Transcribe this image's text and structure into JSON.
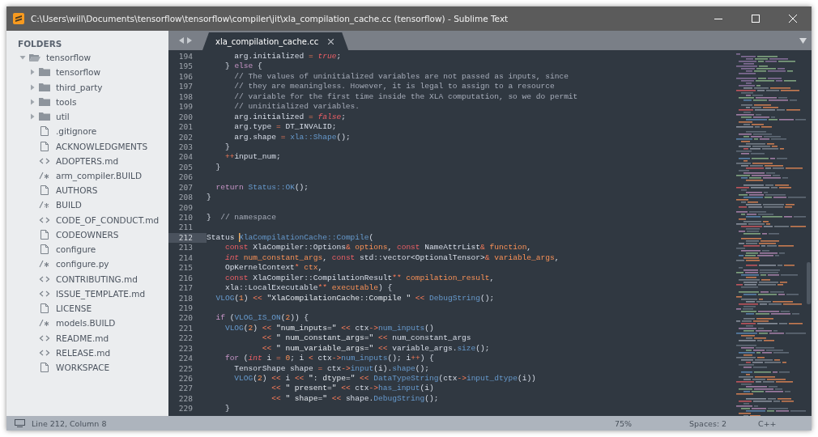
{
  "window": {
    "title": "C:\\Users\\will\\Documents\\tensorflow\\tensorflow\\compiler\\jit\\xla_compilation_cache.cc (tensorflow) - Sublime Text"
  },
  "sidebar": {
    "header": "FOLDERS",
    "tree": [
      {
        "label": "tensorflow",
        "kind": "folder",
        "expanded": true,
        "children": [
          {
            "label": "tensorflow",
            "kind": "folder",
            "expanded": false
          },
          {
            "label": "third_party",
            "kind": "folder",
            "expanded": false
          },
          {
            "label": "tools",
            "kind": "folder",
            "expanded": false
          },
          {
            "label": "util",
            "kind": "folder",
            "expanded": false
          },
          {
            "label": ".gitignore",
            "kind": "file"
          },
          {
            "label": "ACKNOWLEDGMENTS",
            "kind": "file"
          },
          {
            "label": "ADOPTERS.md",
            "kind": "markup"
          },
          {
            "label": "arm_compiler.BUILD",
            "kind": "script"
          },
          {
            "label": "AUTHORS",
            "kind": "file"
          },
          {
            "label": "BUILD",
            "kind": "script"
          },
          {
            "label": "CODE_OF_CONDUCT.md",
            "kind": "markup"
          },
          {
            "label": "CODEOWNERS",
            "kind": "file"
          },
          {
            "label": "configure",
            "kind": "file"
          },
          {
            "label": "configure.py",
            "kind": "script"
          },
          {
            "label": "CONTRIBUTING.md",
            "kind": "markup"
          },
          {
            "label": "ISSUE_TEMPLATE.md",
            "kind": "markup"
          },
          {
            "label": "LICENSE",
            "kind": "file"
          },
          {
            "label": "models.BUILD",
            "kind": "script"
          },
          {
            "label": "README.md",
            "kind": "markup"
          },
          {
            "label": "RELEASE.md",
            "kind": "markup"
          },
          {
            "label": "WORKSPACE",
            "kind": "file"
          }
        ]
      }
    ]
  },
  "tabs": [
    {
      "label": "xla_compilation_cache.cc",
      "selected": true
    }
  ],
  "editor": {
    "lines": [
      {
        "number": "194",
        "current": false,
        "tokens": [
          {
            "kind": "p",
            "text": "      arg.initialized "
          },
          {
            "kind": "o",
            "text": "="
          },
          {
            "kind": "l",
            "text": " true"
          },
          {
            "kind": "p",
            "text": ";"
          }
        ]
      },
      {
        "number": "195",
        "current": false,
        "tokens": [
          {
            "kind": "p",
            "text": "    } "
          },
          {
            "kind": "k",
            "text": "else"
          },
          {
            "kind": "p",
            "text": " {"
          }
        ]
      },
      {
        "number": "196",
        "current": false,
        "tokens": [
          {
            "kind": "c",
            "text": "      // The values of uninitialized variables are not passed as inputs, since"
          }
        ]
      },
      {
        "number": "197",
        "current": false,
        "tokens": [
          {
            "kind": "c",
            "text": "      // they are meaningless. However, it is legal to assign to a resource"
          }
        ]
      },
      {
        "number": "198",
        "current": false,
        "tokens": [
          {
            "kind": "c",
            "text": "      // variable for the first time inside the XLA computation, so we do permit"
          }
        ]
      },
      {
        "number": "199",
        "current": false,
        "tokens": [
          {
            "kind": "c",
            "text": "      // uninitialized variables."
          }
        ]
      },
      {
        "number": "200",
        "current": false,
        "tokens": [
          {
            "kind": "p",
            "text": "      arg.initialized "
          },
          {
            "kind": "o",
            "text": "="
          },
          {
            "kind": "l",
            "text": " false"
          },
          {
            "kind": "p",
            "text": ";"
          }
        ]
      },
      {
        "number": "201",
        "current": false,
        "tokens": [
          {
            "kind": "p",
            "text": "      arg.type "
          },
          {
            "kind": "o",
            "text": "="
          },
          {
            "kind": "p",
            "text": " DT_INVALID;"
          }
        ]
      },
      {
        "number": "202",
        "current": false,
        "tokens": [
          {
            "kind": "p",
            "text": "      arg.shape "
          },
          {
            "kind": "o",
            "text": "="
          },
          {
            "kind": "f",
            "text": " xla::Shape"
          },
          {
            "kind": "p",
            "text": "();"
          }
        ]
      },
      {
        "number": "203",
        "current": false,
        "tokens": [
          {
            "kind": "p",
            "text": "    }"
          }
        ]
      },
      {
        "number": "204",
        "current": false,
        "tokens": [
          {
            "kind": "o",
            "text": "    ++"
          },
          {
            "kind": "p",
            "text": "input_num;"
          }
        ]
      },
      {
        "number": "205",
        "current": false,
        "tokens": [
          {
            "kind": "p",
            "text": "  }"
          }
        ]
      },
      {
        "number": "206",
        "current": false
      },
      {
        "number": "207",
        "current": false,
        "tokens": [
          {
            "kind": "k",
            "text": "  return"
          },
          {
            "kind": "f",
            "text": " Status::OK"
          },
          {
            "kind": "p",
            "text": "();"
          }
        ]
      },
      {
        "number": "208",
        "current": false,
        "tokens": [
          {
            "kind": "p",
            "text": "}"
          }
        ]
      },
      {
        "number": "209",
        "current": false
      },
      {
        "number": "210",
        "current": false,
        "tokens": [
          {
            "kind": "p",
            "text": "}  "
          },
          {
            "kind": "c",
            "text": "// namespace"
          }
        ]
      },
      {
        "number": "211",
        "current": false
      },
      {
        "number": "212",
        "current": true,
        "tokens": [
          {
            "kind": "p",
            "text": "Status "
          },
          {
            "kind": "f",
            "text": "XlaCompilationCache::Compile",
            "cursor": true
          },
          {
            "kind": "p",
            "text": "("
          }
        ]
      },
      {
        "number": "213",
        "current": false,
        "tokens": [
          {
            "kind": "t",
            "text": "    const"
          },
          {
            "kind": "p",
            "text": " XlaCompiler::Options"
          },
          {
            "kind": "o",
            "text": "&"
          },
          {
            "kind": "a",
            "text": " options"
          },
          {
            "kind": "p",
            "text": ", "
          },
          {
            "kind": "t",
            "text": "const"
          },
          {
            "kind": "p",
            "text": " NameAttrList"
          },
          {
            "kind": "o",
            "text": "&"
          },
          {
            "kind": "a",
            "text": " function"
          },
          {
            "kind": "p",
            "text": ","
          }
        ]
      },
      {
        "number": "214",
        "current": false,
        "tokens": [
          {
            "kind": "l",
            "text": "    int"
          },
          {
            "kind": "a",
            "text": " num_constant_args"
          },
          {
            "kind": "p",
            "text": ", "
          },
          {
            "kind": "t",
            "text": "const"
          },
          {
            "kind": "p",
            "text": " std::vector<OptionalTensor>"
          },
          {
            "kind": "o",
            "text": "&"
          },
          {
            "kind": "a",
            "text": " variable_args"
          },
          {
            "kind": "p",
            "text": ","
          }
        ]
      },
      {
        "number": "215",
        "current": false,
        "tokens": [
          {
            "kind": "p",
            "text": "    OpKernelContext"
          },
          {
            "kind": "o",
            "text": "*"
          },
          {
            "kind": "a",
            "text": " ctx"
          },
          {
            "kind": "p",
            "text": ","
          }
        ]
      },
      {
        "number": "216",
        "current": false,
        "tokens": [
          {
            "kind": "t",
            "text": "    const"
          },
          {
            "kind": "p",
            "text": " XlaCompiler::CompilationResult"
          },
          {
            "kind": "o",
            "text": "**"
          },
          {
            "kind": "a",
            "text": " compilation_result"
          },
          {
            "kind": "p",
            "text": ","
          }
        ]
      },
      {
        "number": "217",
        "current": false,
        "tokens": [
          {
            "kind": "p",
            "text": "    xla::LocalExecutable"
          },
          {
            "kind": "o",
            "text": "**"
          },
          {
            "kind": "a",
            "text": " executable"
          },
          {
            "kind": "p",
            "text": ") {"
          }
        ]
      },
      {
        "number": "218",
        "current": false,
        "tokens": [
          {
            "kind": "f",
            "text": "  VLOG"
          },
          {
            "kind": "p",
            "text": "("
          },
          {
            "kind": "n",
            "text": "1"
          },
          {
            "kind": "p",
            "text": ") "
          },
          {
            "kind": "o",
            "text": "<<"
          },
          {
            "kind": "s",
            "text": " \"XlaCompilationCache::Compile \""
          },
          {
            "kind": "o",
            "text": " <<"
          },
          {
            "kind": "f",
            "text": " DebugString"
          },
          {
            "kind": "p",
            "text": "();"
          }
        ]
      },
      {
        "number": "219",
        "current": false
      },
      {
        "number": "220",
        "current": false,
        "tokens": [
          {
            "kind": "k",
            "text": "  if"
          },
          {
            "kind": "p",
            "text": " ("
          },
          {
            "kind": "f",
            "text": "VLOG_IS_ON"
          },
          {
            "kind": "p",
            "text": "("
          },
          {
            "kind": "n",
            "text": "2"
          },
          {
            "kind": "p",
            "text": ")) {"
          }
        ]
      },
      {
        "number": "221",
        "current": false,
        "tokens": [
          {
            "kind": "f",
            "text": "    VLOG"
          },
          {
            "kind": "p",
            "text": "("
          },
          {
            "kind": "n",
            "text": "2"
          },
          {
            "kind": "p",
            "text": ") "
          },
          {
            "kind": "o",
            "text": "<<"
          },
          {
            "kind": "s",
            "text": " \"num_inputs=\""
          },
          {
            "kind": "o",
            "text": " <<"
          },
          {
            "kind": "p",
            "text": " ctx"
          },
          {
            "kind": "o",
            "text": "->"
          },
          {
            "kind": "f",
            "text": "num_inputs"
          },
          {
            "kind": "p",
            "text": "()"
          }
        ]
      },
      {
        "number": "222",
        "current": false,
        "tokens": [
          {
            "kind": "o",
            "text": "            <<"
          },
          {
            "kind": "s",
            "text": " \" num_constant_args=\""
          },
          {
            "kind": "o",
            "text": " <<"
          },
          {
            "kind": "p",
            "text": " num_constant_args"
          }
        ]
      },
      {
        "number": "223",
        "current": false,
        "tokens": [
          {
            "kind": "o",
            "text": "            <<"
          },
          {
            "kind": "s",
            "text": " \" num_variable_args=\""
          },
          {
            "kind": "o",
            "text": " <<"
          },
          {
            "kind": "p",
            "text": " variable_args."
          },
          {
            "kind": "f",
            "text": "size"
          },
          {
            "kind": "p",
            "text": "();"
          }
        ]
      },
      {
        "number": "224",
        "current": false,
        "tokens": [
          {
            "kind": "k",
            "text": "    for"
          },
          {
            "kind": "p",
            "text": " ("
          },
          {
            "kind": "l",
            "text": "int"
          },
          {
            "kind": "p",
            "text": " i "
          },
          {
            "kind": "o",
            "text": "="
          },
          {
            "kind": "n",
            "text": " 0"
          },
          {
            "kind": "p",
            "text": "; i "
          },
          {
            "kind": "o",
            "text": "<"
          },
          {
            "kind": "p",
            "text": " ctx"
          },
          {
            "kind": "o",
            "text": "->"
          },
          {
            "kind": "f",
            "text": "num_inputs"
          },
          {
            "kind": "p",
            "text": "(); i"
          },
          {
            "kind": "o",
            "text": "++"
          },
          {
            "kind": "p",
            "text": ") {"
          }
        ]
      },
      {
        "number": "225",
        "current": false,
        "tokens": [
          {
            "kind": "p",
            "text": "      TensorShape shape "
          },
          {
            "kind": "o",
            "text": "="
          },
          {
            "kind": "p",
            "text": " ctx"
          },
          {
            "kind": "o",
            "text": "->"
          },
          {
            "kind": "f",
            "text": "input"
          },
          {
            "kind": "p",
            "text": "(i)."
          },
          {
            "kind": "f",
            "text": "shape"
          },
          {
            "kind": "p",
            "text": "();"
          }
        ]
      },
      {
        "number": "226",
        "current": false,
        "tokens": [
          {
            "kind": "f",
            "text": "      VLOG"
          },
          {
            "kind": "p",
            "text": "("
          },
          {
            "kind": "n",
            "text": "2"
          },
          {
            "kind": "p",
            "text": ") "
          },
          {
            "kind": "o",
            "text": "<<"
          },
          {
            "kind": "p",
            "text": " i "
          },
          {
            "kind": "o",
            "text": "<<"
          },
          {
            "kind": "s",
            "text": " \": dtype=\""
          },
          {
            "kind": "o",
            "text": " <<"
          },
          {
            "kind": "f",
            "text": " DataTypeString"
          },
          {
            "kind": "p",
            "text": "(ctx"
          },
          {
            "kind": "o",
            "text": "->"
          },
          {
            "kind": "f",
            "text": "input_dtype"
          },
          {
            "kind": "p",
            "text": "(i))"
          }
        ]
      },
      {
        "number": "227",
        "current": false,
        "tokens": [
          {
            "kind": "o",
            "text": "              <<"
          },
          {
            "kind": "s",
            "text": " \" present=\""
          },
          {
            "kind": "o",
            "text": " <<"
          },
          {
            "kind": "p",
            "text": " ctx"
          },
          {
            "kind": "o",
            "text": "->"
          },
          {
            "kind": "f",
            "text": "has_input"
          },
          {
            "kind": "p",
            "text": "(i)"
          }
        ]
      },
      {
        "number": "228",
        "current": false,
        "tokens": [
          {
            "kind": "o",
            "text": "              <<"
          },
          {
            "kind": "s",
            "text": " \" shape=\""
          },
          {
            "kind": "o",
            "text": " <<"
          },
          {
            "kind": "p",
            "text": " shape."
          },
          {
            "kind": "f",
            "text": "DebugString"
          },
          {
            "kind": "p",
            "text": "();"
          }
        ]
      },
      {
        "number": "229",
        "current": false,
        "tokens": [
          {
            "kind": "p",
            "text": "    }"
          }
        ]
      }
    ]
  },
  "status_bar": {
    "position": "Line 212, Column 8",
    "zoom": "75%",
    "indentation": "Spaces: 2",
    "syntax": "C++"
  }
}
